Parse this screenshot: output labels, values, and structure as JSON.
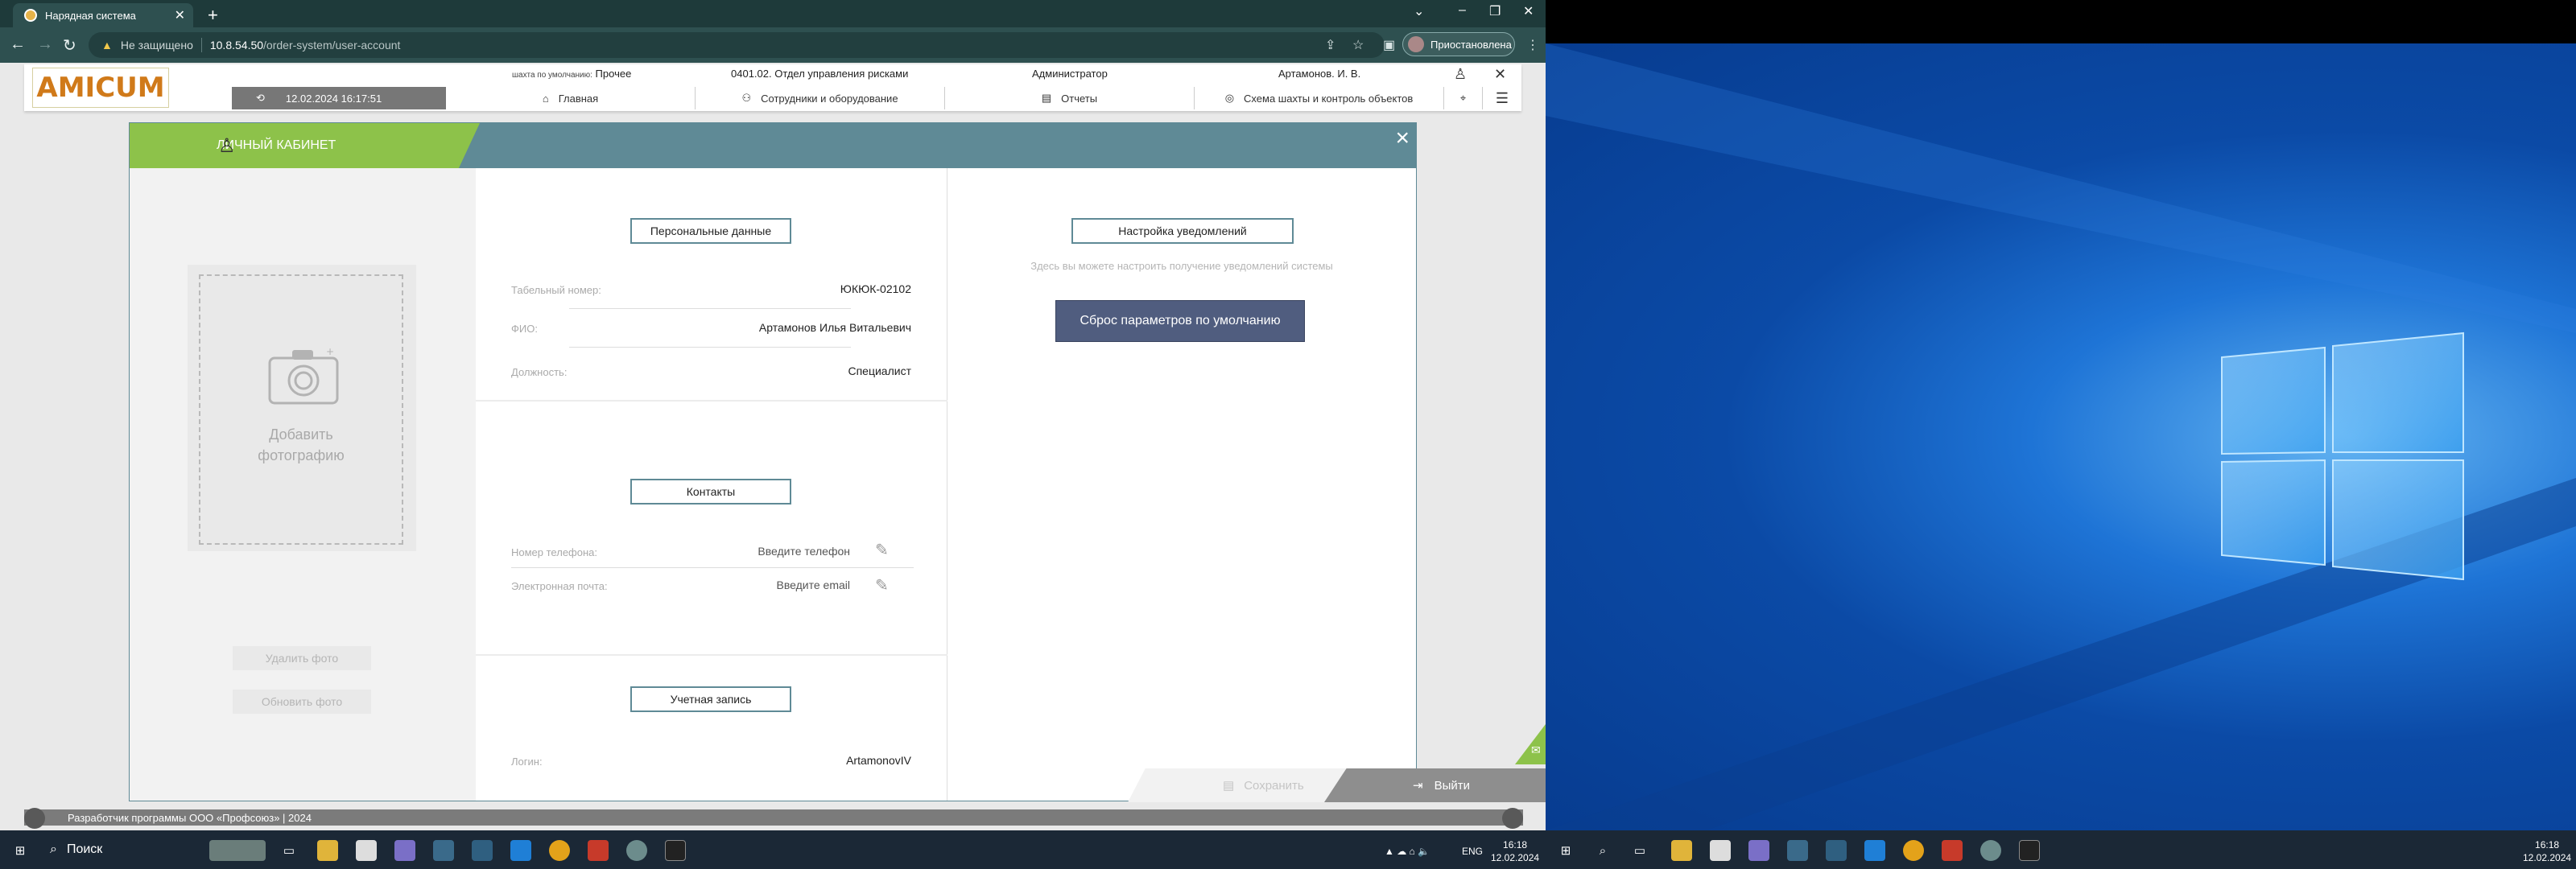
{
  "browser": {
    "tab_title": "Нарядная система",
    "new_tab": "+",
    "security": "Не защищено",
    "url_host": "10.8.54.50",
    "url_path": "/order-system/user-account",
    "profile_status": "Приостановлена"
  },
  "header": {
    "logo_text": "AMICUM",
    "datetime": "12.02.2024 16:17:51",
    "mine_label": "шахта по умолчанию:",
    "mine_value": "Прочее",
    "department": "0401.02. Отдел управления рисками",
    "role": "Администратор",
    "user": "Артамонов. И. В.",
    "nav": [
      {
        "label": "Главная",
        "icon": "home-icon"
      },
      {
        "label": "Сотрудники и оборудование",
        "icon": "workers-icon"
      },
      {
        "label": "Отчеты",
        "icon": "report-icon"
      },
      {
        "label": "Схема шахты и контроль объектов",
        "icon": "mine-scheme-icon"
      }
    ]
  },
  "modal": {
    "title": "ЛИЧНЫЙ КАБИНЕТ",
    "photo": {
      "add_line1": "Добавить",
      "add_line2": "фотографию",
      "delete_btn": "Удалить фото",
      "update_btn": "Обновить фото"
    },
    "personal": {
      "header": "Персональные данные",
      "tab_label": "Табельный номер:",
      "tab_value": "ЮКЮК-02102",
      "fio_label": "ФИО:",
      "fio_value": "Артамонов Илья Витальевич",
      "pos_label": "Должность:",
      "pos_value": "Специалист"
    },
    "contacts": {
      "header": "Контакты",
      "phone_label": "Номер телефона:",
      "phone_placeholder": "Введите телефон",
      "email_label": "Электронная почта:",
      "email_placeholder": "Введите email"
    },
    "account": {
      "header": "Учетная запись",
      "login_label": "Логин:",
      "login_value": "ArtamonovIV"
    },
    "notifications": {
      "header": "Настройка уведомлений",
      "hint": "Здесь вы можете настроить получение уведомлений системы",
      "reset_btn": "Сброс параметров по умолчанию"
    },
    "save_btn": "Сохранить",
    "exit_btn": "Выйти"
  },
  "footer": {
    "developer": "Разработчик программы ООО «Профсоюз» | 2024"
  },
  "taskbar": {
    "search": "Поиск",
    "lang": "ENG",
    "time": "16:18",
    "date": "12.02.2024"
  },
  "colors": {
    "accent_green": "#8dc24a",
    "teal": "#5f8a96",
    "reset_button": "#505d7f"
  }
}
